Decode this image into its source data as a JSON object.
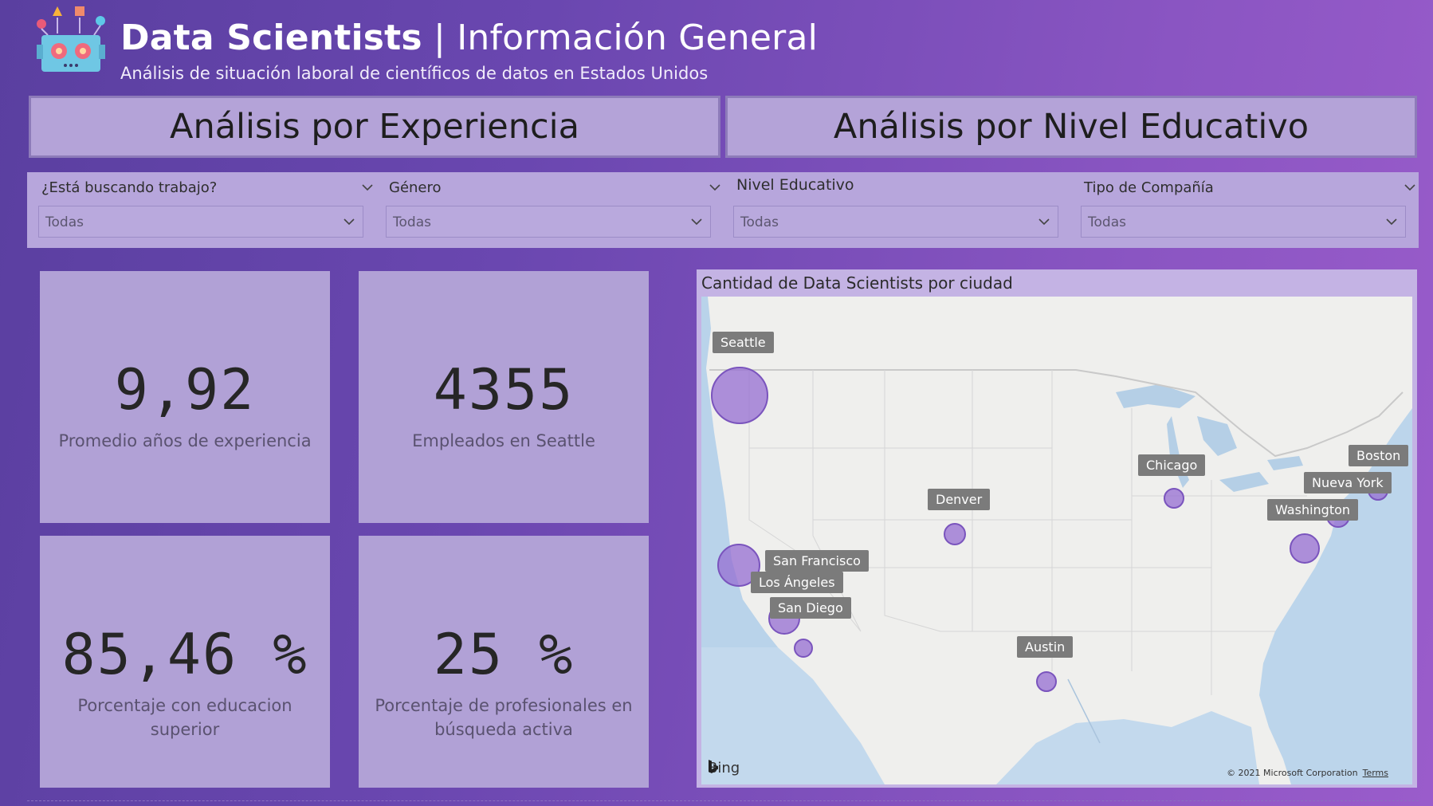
{
  "header": {
    "title_bold": "Data Scientists",
    "title_sep": " | ",
    "title_rest": "Información General",
    "subtitle": "Análisis de situación laboral de científicos de datos en Estados Unidos"
  },
  "nav": {
    "experience": "Análisis por Experiencia",
    "education": "Análisis por Nivel Educativo"
  },
  "filters": [
    {
      "label": "¿Está buscando trabajo?",
      "value": "Todas"
    },
    {
      "label": "Género",
      "value": "Todas"
    },
    {
      "label": "Nivel Educativo",
      "value": "Todas"
    },
    {
      "label": "Tipo de Compañía",
      "value": "Todas"
    }
  ],
  "kpis": {
    "experience": {
      "value": "9,92",
      "label": "Promedio años de experiencia"
    },
    "seattle": {
      "value": "4355",
      "label": "Empleados en Seattle"
    },
    "higher_ed": {
      "value": "85,46 %",
      "label": "Porcentaje con educacion superior"
    },
    "active_search": {
      "value": "25 %",
      "label_1": "Porcentaje de profesionales en",
      "label_2": "búsqueda activa"
    }
  },
  "map": {
    "title": "Cantidad de Data Scientists por ciudad",
    "provider": "Bing",
    "copyright": "© 2021 Microsoft Corporation",
    "terms": "Terms",
    "cities": [
      "Seattle",
      "Chicago",
      "Boston",
      "Nueva York",
      "Washington",
      "Denver",
      "San Francisco",
      "Los Ángeles",
      "San Diego",
      "Austin"
    ]
  },
  "colors": {
    "background": "#6a47b0",
    "panel": "#b1a1d6",
    "bubble": "#966ed2"
  }
}
